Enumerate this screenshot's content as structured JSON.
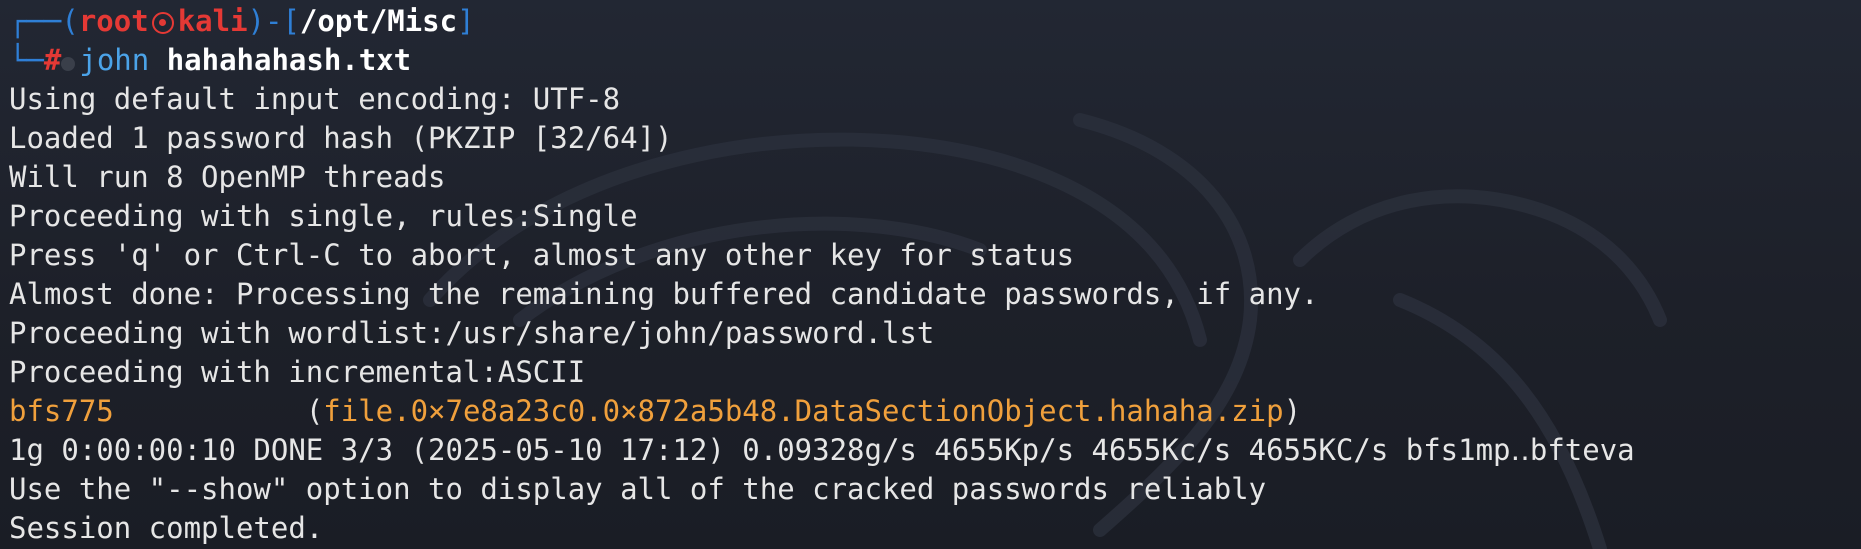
{
  "prompt": {
    "corner_top": "┌──(",
    "user": "root",
    "host": "kali",
    "bracket_mid": ")-[",
    "path": "/opt/Misc",
    "bracket_close": "]",
    "corner_bottom": "└─",
    "hash": "#",
    "command": "john",
    "argument": "hahahahash.txt"
  },
  "output": {
    "line1": "Using default input encoding: UTF-8",
    "line2": "Loaded 1 password hash (PKZIP [32/64])",
    "line3": "Will run 8 OpenMP threads",
    "line4": "Proceeding with single, rules:Single",
    "line5": "Press 'q' or Ctrl-C to abort, almost any other key for status",
    "line6": "Almost done: Processing the remaining buffered candidate passwords, if any.",
    "line7": "Proceeding with wordlist:/usr/share/john/password.lst",
    "line8": "Proceeding with incremental:ASCII",
    "result_password": "bfs775",
    "result_gap": "           (",
    "result_file": "file.0×7e8a23c0.0×872a5b48.DataSectionObject.hahaha.zip",
    "result_close": ")",
    "line10": "1g 0:00:00:10 DONE 3/3 (2025-05-10 17:12) 0.09328g/s 4655Kp/s 4655Kc/s 4655KC/s bfs1mp‥bfteva",
    "line11": "Use the \"--show\" option to display all of the cracked passwords reliably",
    "line12": "Session completed."
  },
  "colors": {
    "background": "#1e222c",
    "prompt_frame": "#2f7fd6",
    "prompt_user": "#e53935",
    "command": "#4ba3e8",
    "highlight": "#f0a03c",
    "text": "#e6e6e6"
  }
}
